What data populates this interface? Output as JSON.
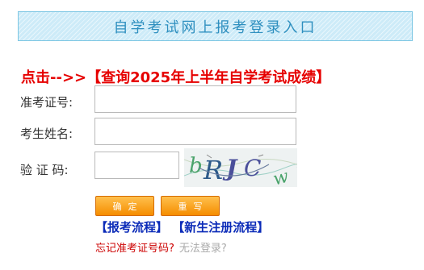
{
  "banner": {
    "title": "自学考试网上报考登录入口"
  },
  "query_link": {
    "prefix": "点击-->>",
    "text": "【查询2025年上半年自学考试成绩】"
  },
  "form": {
    "exam_id_label": "准考证号:",
    "exam_id_value": "",
    "name_label": "考生姓名:",
    "name_value": "",
    "captcha_label": "验 证 码:",
    "captcha_value": "",
    "captcha_text": "bRJCw"
  },
  "buttons": {
    "confirm": "确定",
    "reset": "重写"
  },
  "links": {
    "process": "【报考流程】",
    "register": "【新生注册流程】"
  },
  "help": {
    "forgot_id": "忘记准考证号码?",
    "cannot_login": "无法登录?"
  },
  "colors": {
    "accent": "#e60000",
    "link_blue": "#0b2bb8",
    "button_orange": "#f58d00",
    "banner_text": "#2e8fbf"
  }
}
